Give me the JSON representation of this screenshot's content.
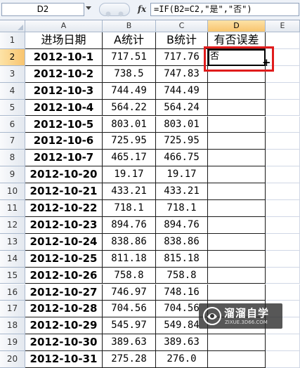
{
  "formula_bar": {
    "name_box": "D2",
    "fx_label": "fx",
    "formula": "=IF(B2=C2,\"是\",\"否\")"
  },
  "columns": [
    "A",
    "B",
    "C",
    "D",
    "E"
  ],
  "selected_column": "D",
  "selected_row": 2,
  "headers": {
    "A": "进场日期",
    "B": "A统计",
    "C": "B统计",
    "D": "有否误差"
  },
  "rows": [
    {
      "num": "2",
      "date": "2012-10-1",
      "a": "717.51",
      "b": "717.76",
      "d": "否"
    },
    {
      "num": "3",
      "date": "2012-10-2",
      "a": "738.5",
      "b": "747.83",
      "d": ""
    },
    {
      "num": "4",
      "date": "2012-10-3",
      "a": "744.49",
      "b": "744.49",
      "d": ""
    },
    {
      "num": "5",
      "date": "2012-10-4",
      "a": "564.22",
      "b": "564.24",
      "d": ""
    },
    {
      "num": "6",
      "date": "2012-10-5",
      "a": "803.01",
      "b": "803.01",
      "d": ""
    },
    {
      "num": "7",
      "date": "2012-10-6",
      "a": "725.95",
      "b": "725.95",
      "d": ""
    },
    {
      "num": "8",
      "date": "2012-10-7",
      "a": "465.17",
      "b": "466.75",
      "d": ""
    },
    {
      "num": "9",
      "date": "2012-10-20",
      "a": "19.17",
      "b": "19.17",
      "d": ""
    },
    {
      "num": "10",
      "date": "2012-10-21",
      "a": "433.21",
      "b": "433.21",
      "d": ""
    },
    {
      "num": "11",
      "date": "2012-10-22",
      "a": "718.1",
      "b": "718.1",
      "d": ""
    },
    {
      "num": "12",
      "date": "2012-10-23",
      "a": "894.76",
      "b": "894.76",
      "d": ""
    },
    {
      "num": "13",
      "date": "2012-10-24",
      "a": "838.86",
      "b": "838.86",
      "d": ""
    },
    {
      "num": "14",
      "date": "2012-10-25",
      "a": "811.18",
      "b": "815.18",
      "d": ""
    },
    {
      "num": "15",
      "date": "2012-10-26",
      "a": "758.8",
      "b": "758.8",
      "d": ""
    },
    {
      "num": "16",
      "date": "2012-10-27",
      "a": "746.97",
      "b": "748.16",
      "d": ""
    },
    {
      "num": "17",
      "date": "2012-10-28",
      "a": "704.56",
      "b": "704.56",
      "d": ""
    },
    {
      "num": "18",
      "date": "2012-10-29",
      "a": "545.97",
      "b": "549.84",
      "d": ""
    },
    {
      "num": "19",
      "date": "2012-10-30",
      "a": "389.63",
      "b": "389.63",
      "d": ""
    },
    {
      "num": "20",
      "date": "2012-10-31",
      "a": "275.28",
      "b": "276.0",
      "d": ""
    }
  ],
  "header_row_num": "1",
  "watermark": {
    "title": "溜溜自学",
    "url": "ZIXUE.3D66.COM"
  },
  "colors": {
    "selection_red": "#e01b1b",
    "header_highlight": "#f8c46e"
  }
}
